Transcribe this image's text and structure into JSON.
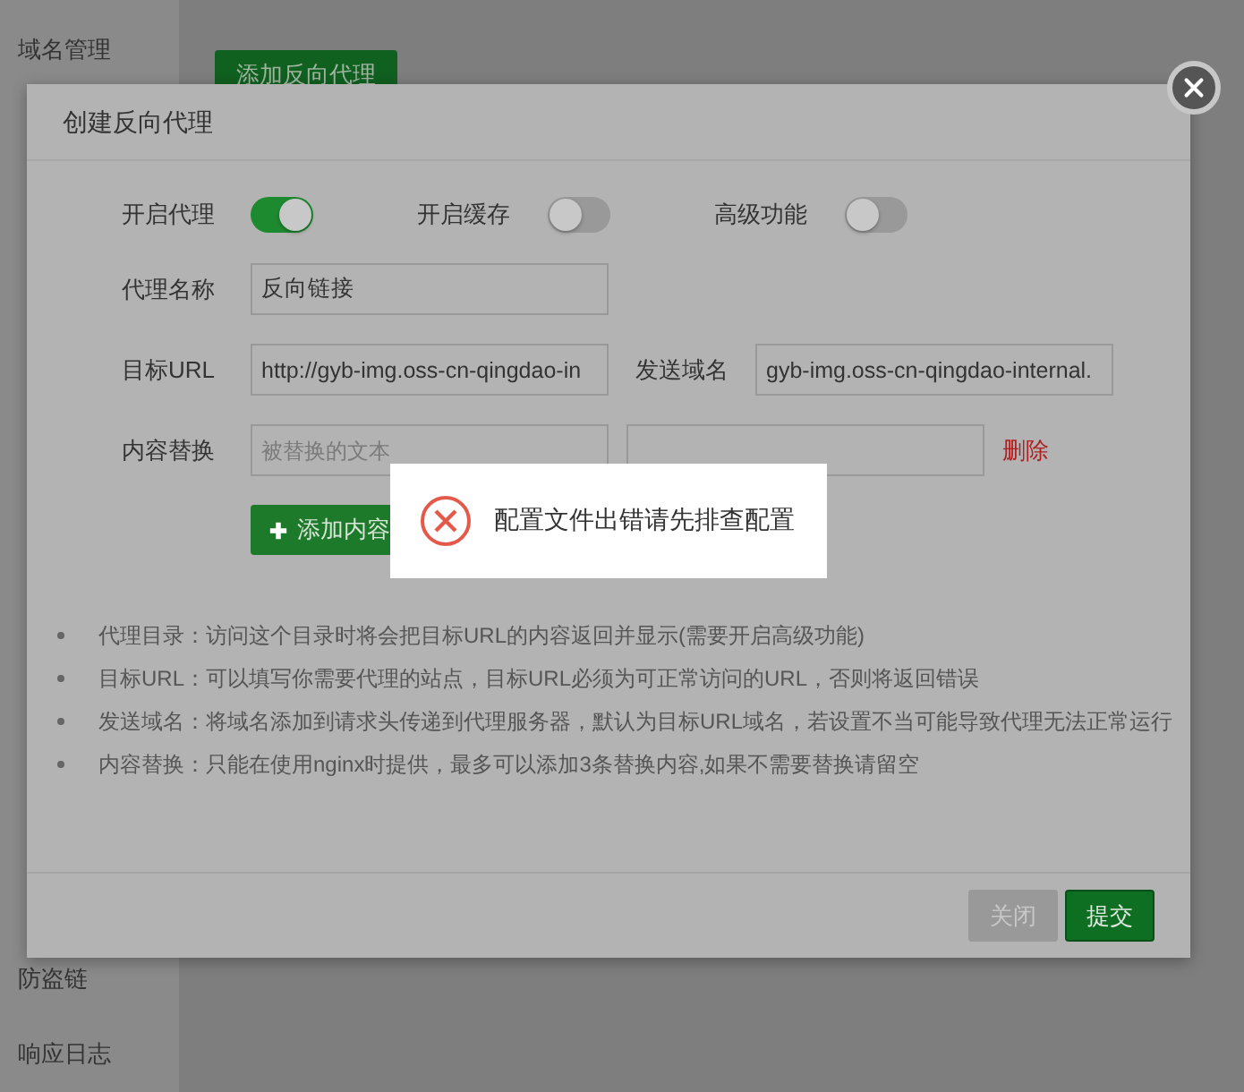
{
  "sidebar": {
    "top_items": [
      {
        "label": "域名管理"
      }
    ],
    "bottom_items": [
      {
        "label": "防盗链"
      },
      {
        "label": "响应日志"
      }
    ]
  },
  "main": {
    "add_button": "添加反向代理"
  },
  "dialog": {
    "title": "创建反向代理",
    "toggles": [
      {
        "label": "开启代理",
        "on": true
      },
      {
        "label": "开启缓存",
        "on": false
      },
      {
        "label": "高级功能",
        "on": false
      }
    ],
    "name_field": {
      "label": "代理名称",
      "value": "反向链接"
    },
    "target_field": {
      "label": "目标URL",
      "value": "http://gyb-img.oss-cn-qingdao-in"
    },
    "host_field": {
      "label": "发送域名",
      "value": "gyb-img.oss-cn-qingdao-internal."
    },
    "replace": {
      "label": "内容替换",
      "placeholder": "被替换的文本",
      "delete_link": "删除"
    },
    "add_replace_button": "添加内容",
    "notes": [
      "代理目录：访问这个目录时将会把目标URL的内容返回并显示(需要开启高级功能)",
      "目标URL：可以填写你需要代理的站点，目标URL必须为可正常访问的URL，否则将返回错误",
      "发送域名：将域名添加到请求头传递到代理服务器，默认为目标URL域名，若设置不当可能导致代理无法正常运行",
      "内容替换：只能在使用nginx时提供，最多可以添加3条替换内容,如果不需要替换请留空"
    ],
    "buttons": [
      {
        "label": "关闭",
        "kind": "secondary"
      },
      {
        "label": "提交",
        "kind": "primary"
      }
    ]
  },
  "toast": {
    "kind": "error",
    "message": "配置文件出错请先排查配置"
  }
}
